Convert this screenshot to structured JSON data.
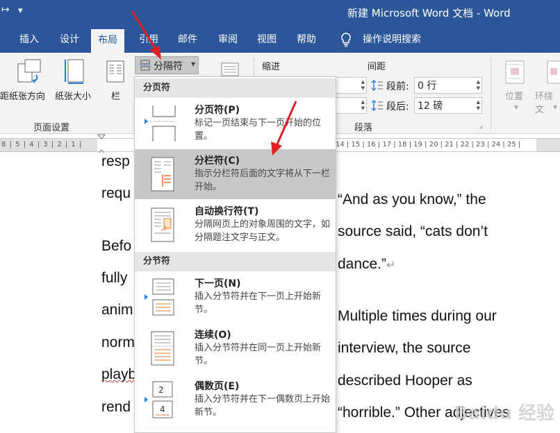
{
  "window": {
    "title": "新建 Microsoft Word 文档  -  Word",
    "qat_dropdown": "▾"
  },
  "tabs": [
    "插入",
    "设计",
    "布局",
    "引用",
    "邮件",
    "审阅",
    "视图",
    "帮助"
  ],
  "active_tab": "布局",
  "tell_me": "操作说明搜索",
  "ribbon": {
    "partial_left_label": "距",
    "orientation_label": "纸张方向",
    "size_label": "纸张大小",
    "columns_label": "栏",
    "breaks_button": "分隔符",
    "page_setup_group": "页面设置",
    "indent_label": "缩进",
    "spacing_label": "间距",
    "before_label": "段前:",
    "before_value": "0 行",
    "after_label": "段后:",
    "after_value": "12 磅",
    "paragraph_group": "段落",
    "position_label": "位置",
    "wrap_label": "环绕文"
  },
  "ruler": {
    "left_ticks": "8 | 5 | 4 | 3 | 2 | 1 |",
    "right_ticks": "14 | 15 | 16 | 17 | 18 | 19 | 20 | 21 | 22 | 23 | 24 | 25 |"
  },
  "menu": {
    "page_breaks_header": "分页符",
    "section_breaks_header": "分节符",
    "items": [
      {
        "title": "分页符(P)",
        "desc": "标记一页结束与下一页开始的位置。"
      },
      {
        "title": "分栏符(C)",
        "desc": "指示分栏符后面的文字将从下一栏开始。"
      },
      {
        "title": "自动换行符(T)",
        "desc": "分隔网页上的对象周围的文字，如分隔题注文字与正文。"
      },
      {
        "title": "下一页(N)",
        "desc": "插入分节符并在下一页上开始新节。"
      },
      {
        "title": "连续(O)",
        "desc": "插入分节符并在同一页上开始新节。"
      },
      {
        "title": "偶数页(E)",
        "desc": "插入分节符并在下一偶数页上开始新节。"
      }
    ]
  },
  "document": {
    "left_column": [
      "resp",
      "requ",
      "Befo",
      "fully",
      "anim",
      "norm",
      "playb",
      "rend"
    ],
    "right_column": [
      "“And as you know,” the",
      "source said, “cats don’t",
      "dance.”",
      "Multiple times during our",
      "interview, the source",
      "described Hooper as",
      "“horrible.” Other adjectives"
    ],
    "paragraph_mark": "↵"
  },
  "watermark": "Baidu 经验",
  "colors": {
    "title_blue": "#2b579a",
    "annotation_red": "#e02020",
    "highlight": "#c8c8c8"
  }
}
